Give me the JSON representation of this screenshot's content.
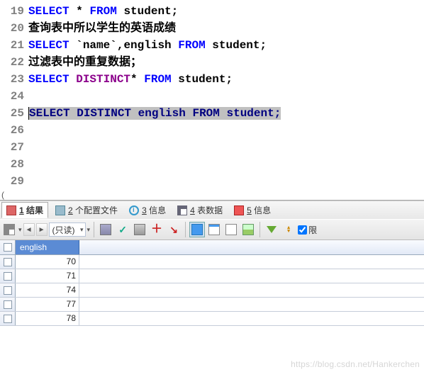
{
  "editor": {
    "lines": [
      {
        "num": "19",
        "tokens": [
          {
            "t": "SELECT",
            "c": "kw"
          },
          {
            "t": " "
          },
          {
            "t": "*",
            "c": "ident"
          },
          {
            "t": " "
          },
          {
            "t": "FROM",
            "c": "kw"
          },
          {
            "t": " "
          },
          {
            "t": "student",
            "c": "ident"
          },
          {
            "t": ";",
            "c": "ident"
          }
        ]
      },
      {
        "num": "20",
        "comment": "查询表中所以学生的英语成绩"
      },
      {
        "num": "21",
        "tokens": [
          {
            "t": "SELECT",
            "c": "kw"
          },
          {
            "t": " "
          },
          {
            "t": "`name`",
            "c": "ident"
          },
          {
            "t": ",",
            "c": "ident"
          },
          {
            "t": "english",
            "c": "ident"
          },
          {
            "t": " "
          },
          {
            "t": "FROM",
            "c": "kw"
          },
          {
            "t": " "
          },
          {
            "t": "student",
            "c": "ident"
          },
          {
            "t": ";",
            "c": "ident"
          }
        ]
      },
      {
        "num": "22",
        "comment": "过滤表中的重复数据；"
      },
      {
        "num": "23",
        "tokens": [
          {
            "t": "SELECT",
            "c": "kw"
          },
          {
            "t": " "
          },
          {
            "t": "DISTINCT",
            "c": "fn"
          },
          {
            "t": "*",
            "c": "ident"
          },
          {
            "t": " "
          },
          {
            "t": "FROM",
            "c": "kw"
          },
          {
            "t": " "
          },
          {
            "t": "student",
            "c": "ident"
          },
          {
            "t": ";",
            "c": "ident"
          }
        ]
      },
      {
        "num": "24",
        "blank": true
      },
      {
        "num": "25",
        "highlight": true,
        "tokens": [
          {
            "t": "SELECT",
            "c": "hl-text"
          },
          {
            "t": " "
          },
          {
            "t": "DISTINCT",
            "c": "hl-text"
          },
          {
            "t": " "
          },
          {
            "t": "english",
            "c": "hl-text"
          },
          {
            "t": " "
          },
          {
            "t": "FROM",
            "c": "hl-text"
          },
          {
            "t": " "
          },
          {
            "t": "student;",
            "c": "hl-text"
          }
        ]
      },
      {
        "num": "26",
        "blank": true
      },
      {
        "num": "27",
        "blank": true
      },
      {
        "num": "28",
        "blank": true
      },
      {
        "num": "29",
        "blank": true
      }
    ]
  },
  "barX": "(",
  "tabs": [
    {
      "label": "1 结果",
      "u": "1",
      "active": true,
      "icon": "ico-table"
    },
    {
      "label": "2 个配置文件",
      "u": "2",
      "icon": "ico-file"
    },
    {
      "label": "3 信息",
      "u": "3",
      "icon": "ico-info"
    },
    {
      "label": "4 表数据",
      "u": "4",
      "icon": "ico-grid"
    },
    {
      "label": "5 信息",
      "u": "5",
      "icon": "ico-msg"
    }
  ],
  "toolbar": {
    "readonly": "(只读)",
    "checkbox_label": "限"
  },
  "grid": {
    "column": "english",
    "rows": [
      "70",
      "71",
      "74",
      "77",
      "78"
    ]
  },
  "watermark": "https://blog.csdn.net/Hankerchen"
}
